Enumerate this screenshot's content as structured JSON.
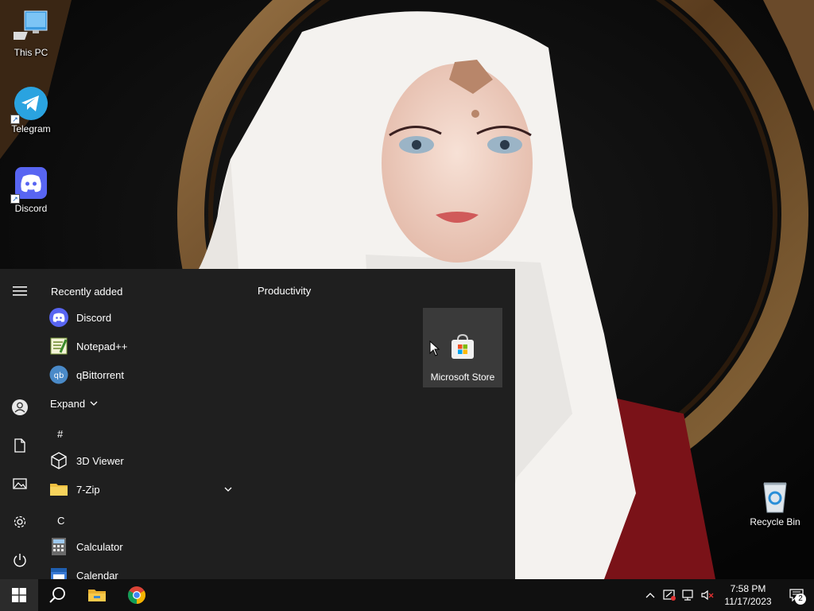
{
  "desktop": {
    "icons": [
      {
        "label": "This PC",
        "icon": "computer-icon"
      },
      {
        "label": "Telegram",
        "icon": "telegram-icon"
      },
      {
        "label": "Discord",
        "icon": "discord-icon"
      },
      {
        "label": "Recycle Bin",
        "icon": "recycle-bin-icon"
      }
    ]
  },
  "start_menu": {
    "recently_added_title": "Recently added",
    "recent": [
      {
        "label": "Discord",
        "icon": "discord-icon"
      },
      {
        "label": "Notepad++",
        "icon": "notepadpp-icon"
      },
      {
        "label": "qBittorrent",
        "icon": "qbittorrent-icon"
      }
    ],
    "expand_label": "Expand",
    "letter_hash": "#",
    "apps_hash": [
      {
        "label": "3D Viewer",
        "icon": "cube-icon"
      },
      {
        "label": "7-Zip",
        "icon": "folder-icon",
        "expandable": true
      }
    ],
    "letter_c": "C",
    "apps_c": [
      {
        "label": "Calculator",
        "icon": "calculator-icon"
      },
      {
        "label": "Calendar",
        "icon": "calendar-icon"
      }
    ],
    "tile_group_title": "Productivity",
    "tiles": [
      {
        "label": "Microsoft Store",
        "icon": "store-icon"
      }
    ]
  },
  "taskbar": {
    "pinned": [
      "start-icon",
      "search-icon",
      "file-explorer-icon",
      "chrome-icon"
    ],
    "clock_time": "7:58 PM",
    "clock_date": "11/17/2023",
    "notification_count": "2"
  },
  "colors": {
    "start_bg": "#1f1f1f",
    "taskbar_bg": "#101010",
    "tile_bg": "#3a3a3a",
    "accent": "#0078d4"
  }
}
